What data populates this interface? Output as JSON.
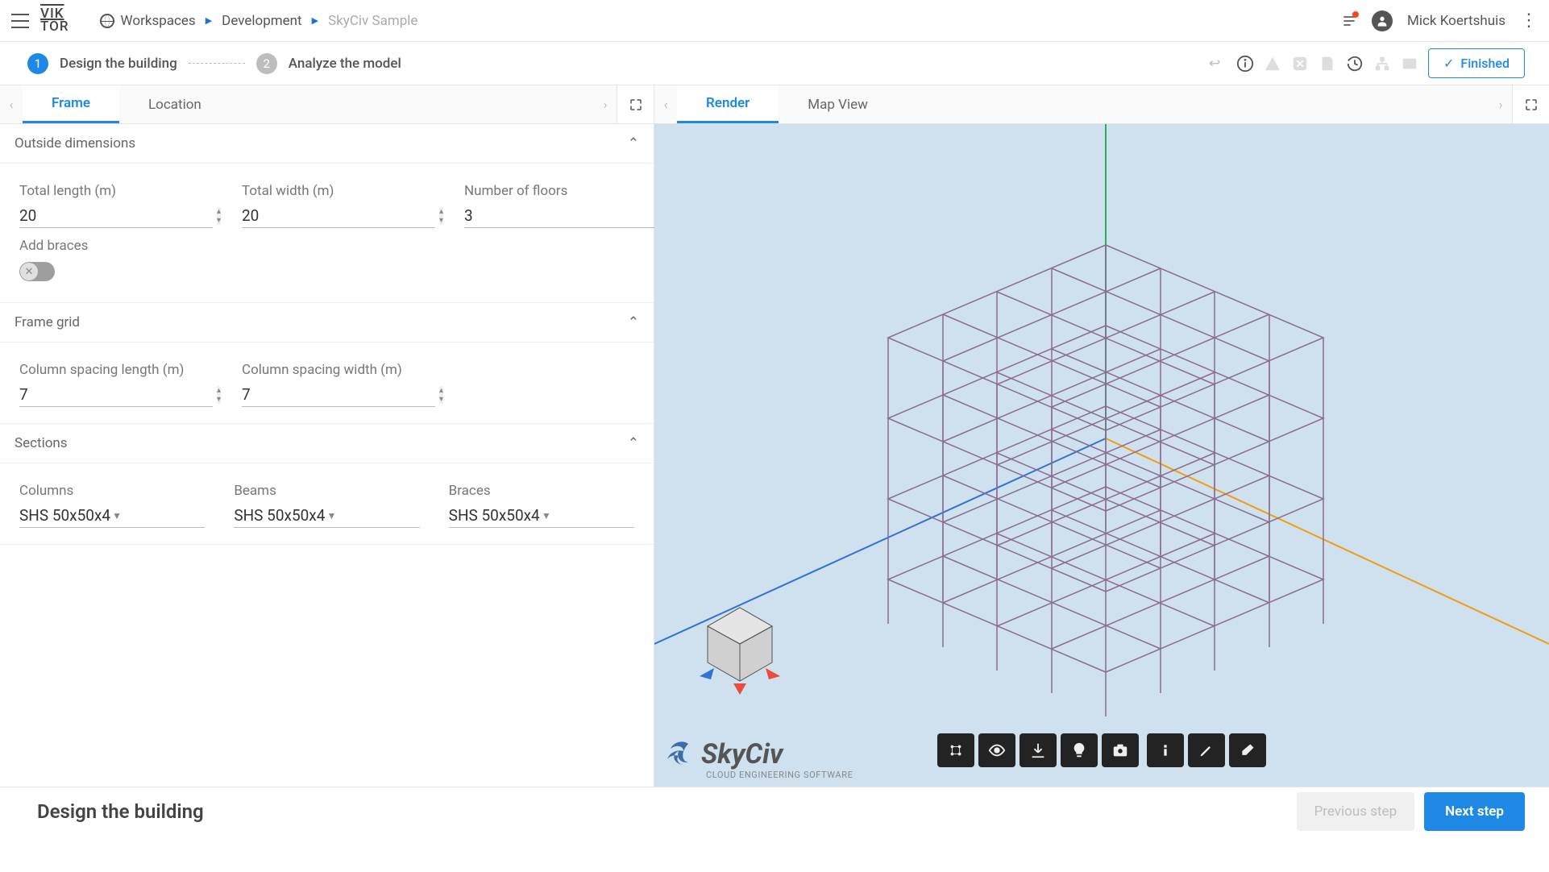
{
  "brand": "VIKTOR",
  "breadcrumbs": {
    "workspaces": "Workspaces",
    "dev": "Development",
    "sample": "SkyCiv Sample"
  },
  "user": {
    "name": "Mick Koertshuis"
  },
  "steps": {
    "s1_num": "1",
    "s1_label": "Design the building",
    "s2_num": "2",
    "s2_label": "Analyze the model",
    "finished": "Finished"
  },
  "leftTabs": {
    "frame": "Frame",
    "location": "Location"
  },
  "rightTabs": {
    "render": "Render",
    "map": "Map View"
  },
  "sections": {
    "outside": "Outside dimensions",
    "framegrid": "Frame grid",
    "sections": "Sections"
  },
  "fields": {
    "total_length_label": "Total length (m)",
    "total_length": "20",
    "total_width_label": "Total width (m)",
    "total_width": "20",
    "num_floors_label": "Number of floors",
    "num_floors": "3",
    "add_braces_label": "Add braces",
    "col_spacing_len_label": "Column spacing length (m)",
    "col_spacing_len": "7",
    "col_spacing_wid_label": "Column spacing width (m)",
    "col_spacing_wid": "7",
    "columns_label": "Columns",
    "columns": "SHS 50x50x4",
    "beams_label": "Beams",
    "beams": "SHS 50x50x4",
    "braces_label": "Braces",
    "braces": "SHS 50x50x4"
  },
  "footer": {
    "title": "Design the building",
    "prev": "Previous step",
    "next": "Next step"
  },
  "skyciv": {
    "brand": "SkyCiv",
    "tagline": "CLOUD ENGINEERING SOFTWARE"
  }
}
